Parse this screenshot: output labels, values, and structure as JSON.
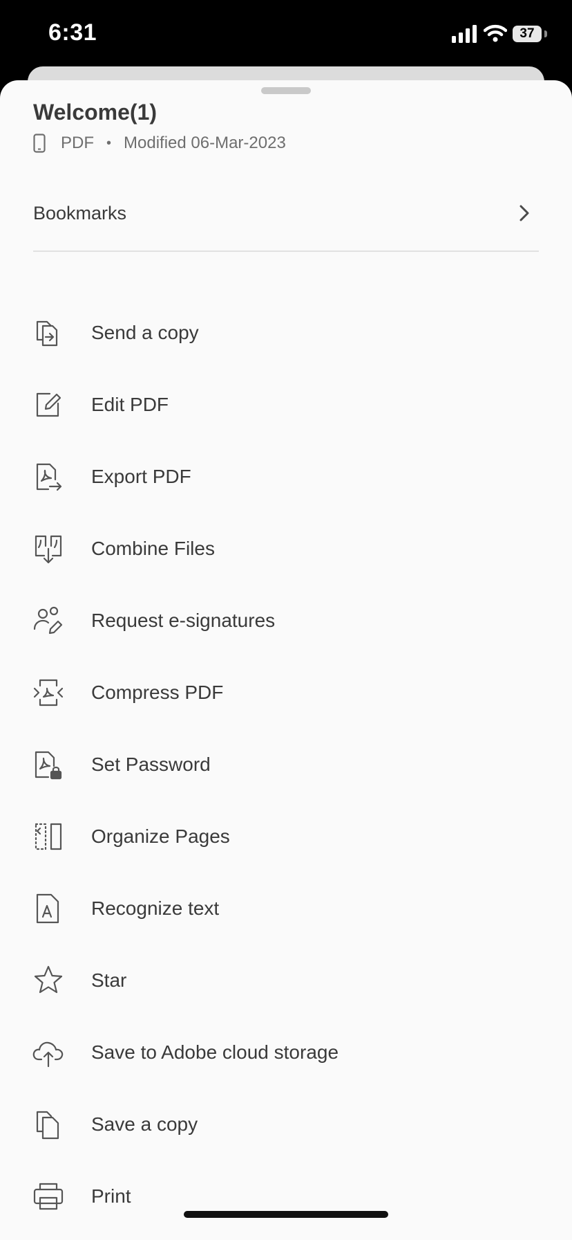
{
  "status_bar": {
    "time": "6:31",
    "battery": "37"
  },
  "document": {
    "title": "Welcome(1)",
    "type": "PDF",
    "separator": "•",
    "modified": "Modified 06-Mar-2023"
  },
  "bookmarks": {
    "label": "Bookmarks"
  },
  "menu": [
    {
      "label": "Send a copy",
      "icon": "send-copy-icon"
    },
    {
      "label": "Edit PDF",
      "icon": "edit-icon"
    },
    {
      "label": "Export PDF",
      "icon": "export-pdf-icon"
    },
    {
      "label": "Combine Files",
      "icon": "combine-files-icon"
    },
    {
      "label": "Request e-signatures",
      "icon": "request-signatures-icon"
    },
    {
      "label": "Compress PDF",
      "icon": "compress-pdf-icon"
    },
    {
      "label": "Set Password",
      "icon": "set-password-icon"
    },
    {
      "label": "Organize Pages",
      "icon": "organize-pages-icon"
    },
    {
      "label": "Recognize text",
      "icon": "recognize-text-icon"
    },
    {
      "label": "Star",
      "icon": "star-icon"
    },
    {
      "label": "Save to Adobe cloud storage",
      "icon": "cloud-upload-icon"
    },
    {
      "label": "Save a copy",
      "icon": "save-copy-icon"
    },
    {
      "label": "Print",
      "icon": "print-icon"
    }
  ]
}
